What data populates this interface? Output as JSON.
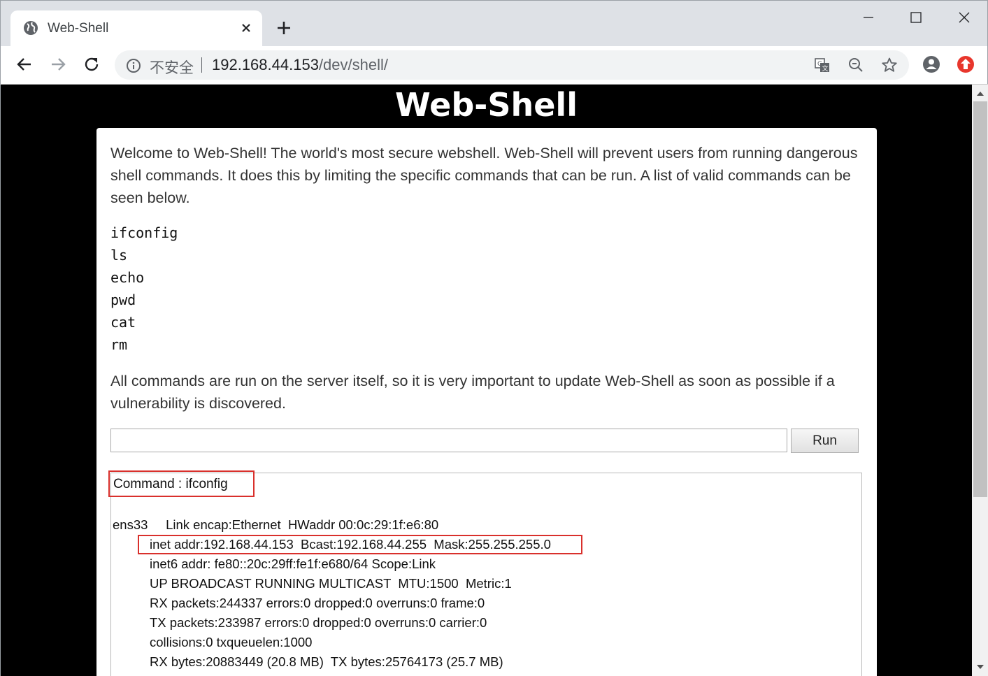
{
  "browser": {
    "tab_title": "Web-Shell",
    "insecure_label": "不安全",
    "url_host": "192.168.44.153",
    "url_path": "/dev/shell/"
  },
  "page": {
    "title": "Web-Shell",
    "intro": "Welcome to Web-Shell! The world's most secure webshell. Web-Shell will prevent users from running dangerous shell commands. It does this by limiting the specific commands that can be run. A list of valid commands can be seen below.",
    "commands": [
      "ifconfig",
      "ls",
      "echo",
      "pwd",
      "cat",
      "rm"
    ],
    "warning": "All commands are run on the server itself, so it is very important to update Web-Shell as soon as possible if a vulnerability is discovered.",
    "input_value": "",
    "run_label": "Run"
  },
  "output": {
    "command_line": "Command : ifconfig",
    "lines": [
      "ens33     Link encap:Ethernet  HWaddr 00:0c:29:1f:e6:80",
      "inet addr:192.168.44.153  Bcast:192.168.44.255  Mask:255.255.255.0",
      "inet6 addr: fe80::20c:29ff:fe1f:e680/64 Scope:Link",
      "UP BROADCAST RUNNING MULTICAST  MTU:1500  Metric:1",
      "RX packets:244337 errors:0 dropped:0 overruns:0 frame:0",
      "TX packets:233987 errors:0 dropped:0 overruns:0 carrier:0",
      "collisions:0 txqueuelen:1000",
      "RX bytes:20883449 (20.8 MB)  TX bytes:25764173 (25.7 MB)"
    ]
  },
  "colors": {
    "page_background": "#000000",
    "highlight_border": "#d9302c",
    "extension_icon": "#e8362c"
  },
  "icons": [
    "globe-icon",
    "close-icon",
    "plus-icon",
    "minimize-icon",
    "maximize-icon",
    "window-close-icon",
    "back-arrow-icon",
    "forward-arrow-icon",
    "reload-icon",
    "info-icon",
    "translate-icon",
    "zoom-icon",
    "star-icon",
    "profile-icon",
    "extension-icon",
    "scroll-up-icon",
    "scroll-down-icon"
  ]
}
